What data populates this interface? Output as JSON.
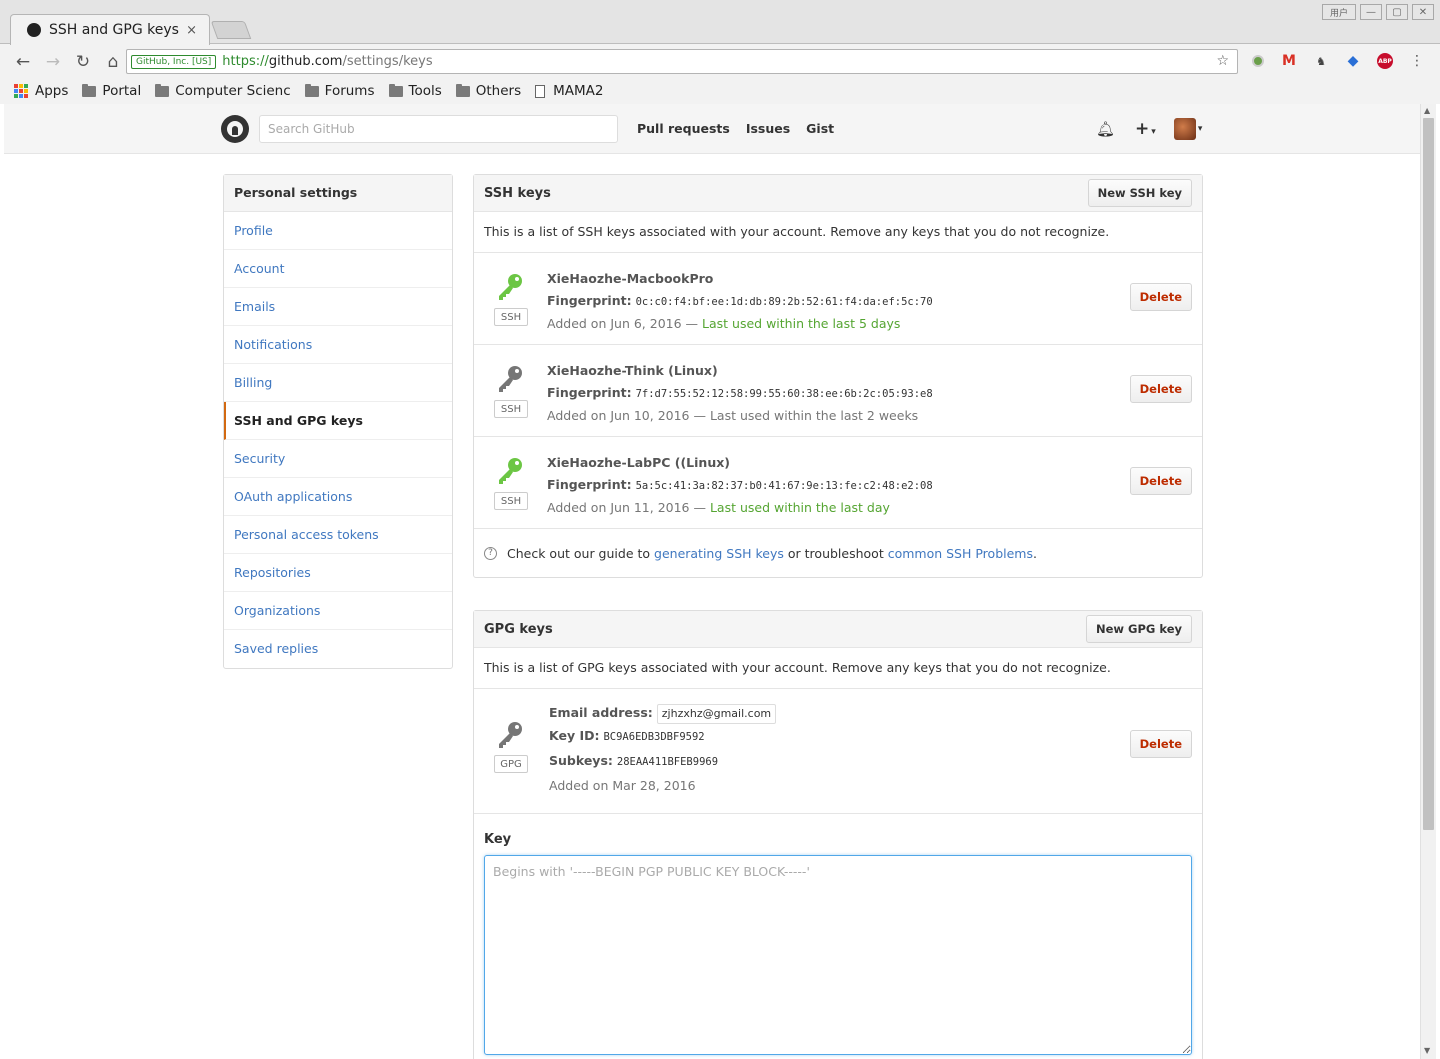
{
  "browser": {
    "tab_title": "SSH and GPG keys",
    "tab_close": "×",
    "window_user": "用户",
    "ev_badge": "GitHub, Inc. [US]",
    "url_scheme": "https://",
    "url_host": "github.com",
    "url_path": "/settings/keys",
    "bookmarks": {
      "apps": "Apps",
      "portal": "Portal",
      "cs": "Computer Scienc",
      "forums": "Forums",
      "tools": "Tools",
      "others": "Others",
      "mama2": "MAMA2"
    }
  },
  "header": {
    "search_placeholder": "Search GitHub",
    "nav": [
      "Pull requests",
      "Issues",
      "Gist"
    ]
  },
  "sidebar": {
    "heading": "Personal settings",
    "items": [
      {
        "label": "Profile"
      },
      {
        "label": "Account"
      },
      {
        "label": "Emails"
      },
      {
        "label": "Notifications"
      },
      {
        "label": "Billing"
      },
      {
        "label": "SSH and GPG keys",
        "selected": true
      },
      {
        "label": "Security"
      },
      {
        "label": "OAuth applications"
      },
      {
        "label": "Personal access tokens"
      },
      {
        "label": "Repositories"
      },
      {
        "label": "Organizations"
      },
      {
        "label": "Saved replies"
      }
    ]
  },
  "ssh": {
    "title": "SSH keys",
    "new_button": "New SSH key",
    "intro": "This is a list of SSH keys associated with your account. Remove any keys that you do not recognize.",
    "fingerprint_label": "Fingerprint:",
    "badge": "SSH",
    "delete_label": "Delete",
    "keys": [
      {
        "name": "XieHaozhe-MacbookPro",
        "fingerprint": "0c:c0:f4:bf:ee:1d:db:89:2b:52:61:f4:da:ef:5c:70",
        "added": "Added on Jun 6, 2016 —",
        "used": "Last used within the last 5 days",
        "recent": true
      },
      {
        "name": "XieHaozhe-Think (Linux)",
        "fingerprint": "7f:d7:55:52:12:58:99:55:60:38:ee:6b:2c:05:93:e8",
        "added": "Added on Jun 10, 2016 —",
        "used": "Last used within the last 2 weeks",
        "recent": false
      },
      {
        "name": "XieHaozhe-LabPC ((Linux)",
        "fingerprint": "5a:5c:41:3a:82:37:b0:41:67:9e:13:fe:c2:48:e2:08",
        "added": "Added on Jun 11, 2016 —",
        "used": "Last used within the last day",
        "recent": true
      }
    ],
    "help_prefix": "Check out our guide to",
    "help_link1": "generating SSH keys",
    "help_mid": "or troubleshoot",
    "help_link2": "common SSH Problems",
    "help_suffix": "."
  },
  "gpg": {
    "title": "GPG keys",
    "new_button": "New GPG key",
    "intro": "This is a list of GPG keys associated with your account. Remove any keys that you do not recognize.",
    "badge": "GPG",
    "email_label": "Email address:",
    "email": "zjhzxhz@gmail.com",
    "keyid_label": "Key ID:",
    "keyid": "BC9A6EDB3DBF9592",
    "subkeys_label": "Subkeys:",
    "subkeys": "28EAA411BFEB9969",
    "added": "Added on Mar 28, 2016",
    "delete_label": "Delete",
    "form_label": "Key",
    "form_placeholder": "Begins with '-----BEGIN PGP PUBLIC KEY BLOCK-----'"
  },
  "colors": {
    "link": "#4078c0",
    "recent_green": "#55a532",
    "active_key": "#6cc644",
    "stale_key": "#767676",
    "danger": "#bd2c00",
    "selected_bar": "#d26911"
  }
}
